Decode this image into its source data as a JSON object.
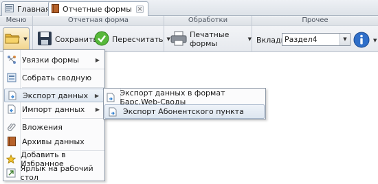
{
  "tabs": [
    {
      "label": "Главная",
      "icon": "home-icon"
    },
    {
      "label": "Отчетные формы",
      "icon": "book-icon",
      "closable": true,
      "close_glyph": "×"
    }
  ],
  "ribbon": {
    "groups": {
      "menu": "Меню",
      "report_form": "Отчетная форма",
      "processing": "Обработки",
      "other": "Прочее"
    },
    "buttons": {
      "save": "Сохранить",
      "recalc": "Пересчитать",
      "print_forms": "Печатные формы"
    },
    "tab_select": {
      "label": "Вкладка",
      "value": "Раздел4"
    }
  },
  "menu": {
    "items": [
      {
        "label": "Увязки формы",
        "icon": "links-icon",
        "has_submenu": true
      },
      {
        "label": "Собрать сводную",
        "icon": "collect-icon",
        "has_submenu": false
      },
      {
        "label": "Экспорт данных",
        "icon": "export-icon",
        "has_submenu": true,
        "active": true
      },
      {
        "label": "Импорт данных",
        "icon": "import-icon",
        "has_submenu": true
      },
      {
        "label": "Вложения",
        "icon": "paperclip-icon",
        "has_submenu": false
      },
      {
        "label": "Архивы данных",
        "icon": "archive-icon",
        "has_submenu": false
      },
      {
        "label": "Добавить в Избранное",
        "icon": "star-icon",
        "has_submenu": false
      },
      {
        "label": "Ярлык на рабочий стол",
        "icon": "shortcut-icon",
        "has_submenu": false
      }
    ]
  },
  "submenu": {
    "items": [
      {
        "label": "Экспорт данных в формат Барс.Web-Своды",
        "icon": "document-export-icon"
      },
      {
        "label": "Экспорт Абонентского пункта",
        "icon": "document-export-icon",
        "hover": true
      }
    ]
  },
  "colors": {
    "accent_blue": "#2f6fc9",
    "recalc_green": "#4caf2f",
    "folder_yellow": "#f3c44a",
    "menu_hover": "#dde6f0"
  }
}
